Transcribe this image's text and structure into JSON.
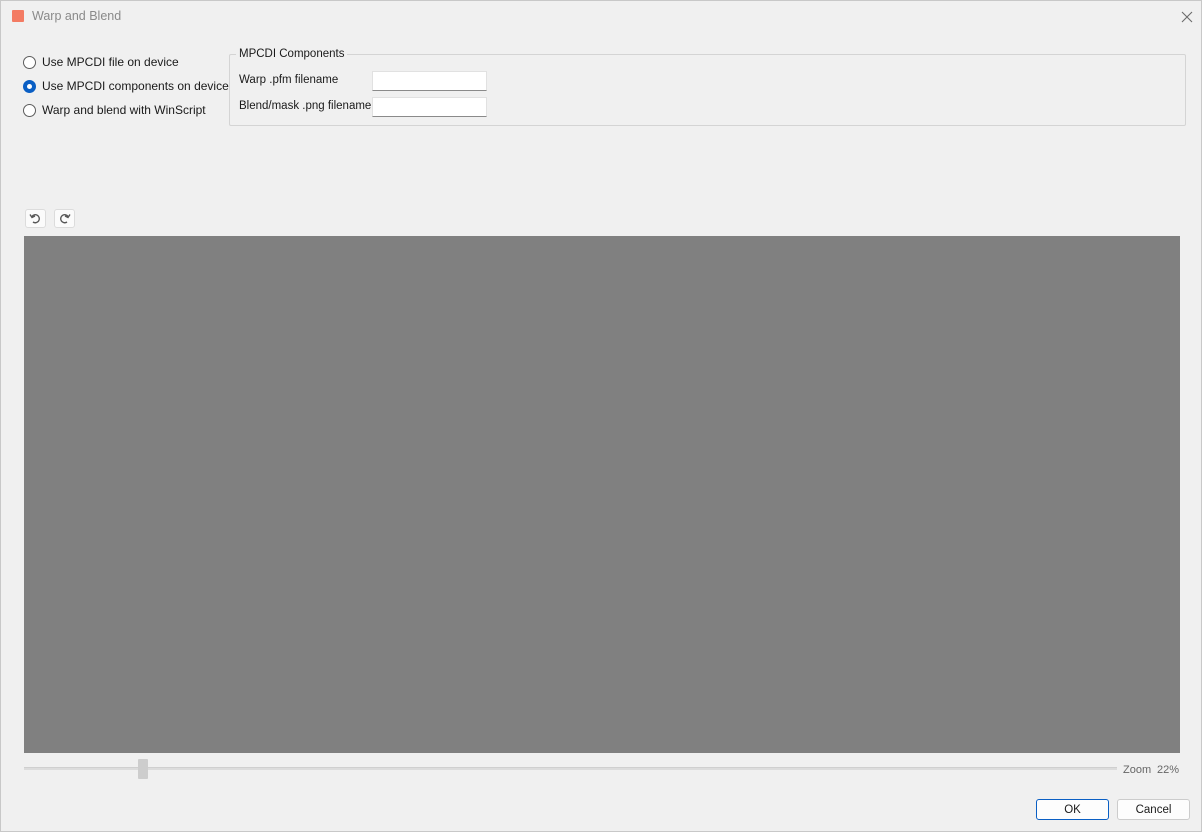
{
  "window": {
    "title": "Warp and Blend"
  },
  "options": [
    {
      "label": "Use MPCDI file on device",
      "checked": false
    },
    {
      "label": "Use MPCDI components on device",
      "checked": true
    },
    {
      "label": "Warp and blend with WinScript",
      "checked": false
    }
  ],
  "components": {
    "legend": "MPCDI Components",
    "warp_label": "Warp .pfm filename",
    "warp_value": "",
    "blend_label": "Blend/mask .png filename",
    "blend_value": ""
  },
  "toolbar": {
    "undo_icon": "undo-icon",
    "redo_icon": "redo-icon"
  },
  "preview": {
    "background": "#808080"
  },
  "zoom": {
    "label": "Zoom",
    "value_text": "22%",
    "level": 0.1
  },
  "buttons": {
    "ok": "OK",
    "cancel": "Cancel"
  },
  "colors": {
    "accent": "#0a5fc4",
    "app_icon": "#f37b63"
  }
}
